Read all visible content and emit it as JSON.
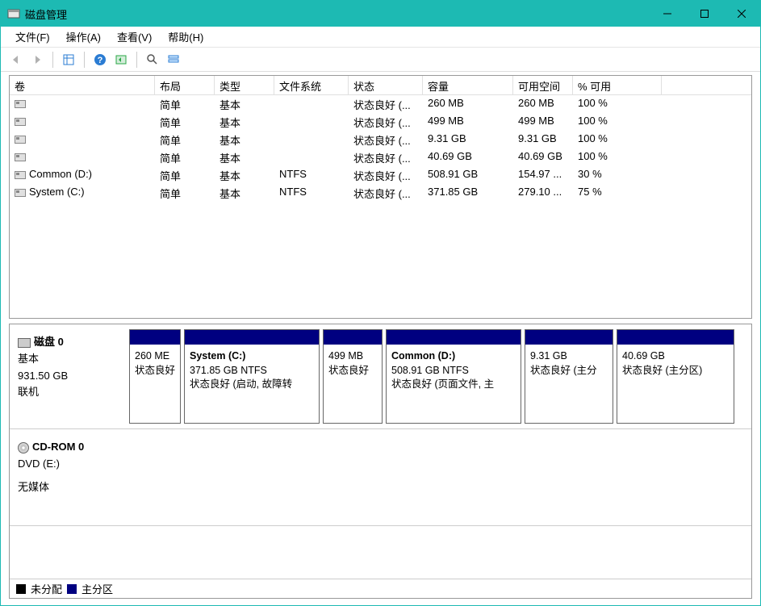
{
  "window": {
    "title": "磁盘管理"
  },
  "menu": {
    "file": "文件(F)",
    "action": "操作(A)",
    "view": "查看(V)",
    "help": "帮助(H)"
  },
  "columns": {
    "volume": "卷",
    "layout": "布局",
    "type": "类型",
    "filesystem": "文件系统",
    "status": "状态",
    "capacity": "容量",
    "free": "可用空间",
    "pctfree": "% 可用"
  },
  "volumes": [
    {
      "name": "",
      "layout": "简单",
      "type": "基本",
      "fs": "",
      "status": "状态良好 (...",
      "cap": "260 MB",
      "free": "260 MB",
      "pct": "100 %"
    },
    {
      "name": "",
      "layout": "简单",
      "type": "基本",
      "fs": "",
      "status": "状态良好 (...",
      "cap": "499 MB",
      "free": "499 MB",
      "pct": "100 %"
    },
    {
      "name": "",
      "layout": "简单",
      "type": "基本",
      "fs": "",
      "status": "状态良好 (...",
      "cap": "9.31 GB",
      "free": "9.31 GB",
      "pct": "100 %"
    },
    {
      "name": "",
      "layout": "简单",
      "type": "基本",
      "fs": "",
      "status": "状态良好 (...",
      "cap": "40.69 GB",
      "free": "40.69 GB",
      "pct": "100 %"
    },
    {
      "name": "Common (D:)",
      "layout": "简单",
      "type": "基本",
      "fs": "NTFS",
      "status": "状态良好 (...",
      "cap": "508.91 GB",
      "free": "154.97 ...",
      "pct": "30 %"
    },
    {
      "name": "System (C:)",
      "layout": "简单",
      "type": "基本",
      "fs": "NTFS",
      "status": "状态良好 (...",
      "cap": "371.85 GB",
      "free": "279.10 ...",
      "pct": "75 %"
    }
  ],
  "disk0": {
    "label": "磁盘 0",
    "type": "基本",
    "capacity": "931.50 GB",
    "status": "联机",
    "parts": [
      {
        "name": "",
        "size": "260 ME",
        "status": "状态良好",
        "w": 64
      },
      {
        "name": "System  (C:)",
        "size": "371.85 GB NTFS",
        "status": "状态良好 (启动, 故障转",
        "w": 168
      },
      {
        "name": "",
        "size": "499 MB",
        "status": "状态良好",
        "w": 74
      },
      {
        "name": "Common  (D:)",
        "size": "508.91 GB NTFS",
        "status": "状态良好 (页面文件, 主",
        "w": 168
      },
      {
        "name": "",
        "size": "9.31 GB",
        "status": "状态良好 (主分",
        "w": 110
      },
      {
        "name": "",
        "size": "40.69 GB",
        "status": "状态良好 (主分区)",
        "w": 146
      }
    ]
  },
  "cdrom": {
    "label": "CD-ROM 0",
    "drive": "DVD (E:)",
    "status": "无媒体"
  },
  "legend": {
    "unallocated": "未分配",
    "primary": "主分区"
  },
  "colwidths": {
    "volume": 180,
    "layout": 74,
    "type": 74,
    "filesystem": 92,
    "status": 92,
    "capacity": 112,
    "free": 74,
    "pctfree": 110
  }
}
